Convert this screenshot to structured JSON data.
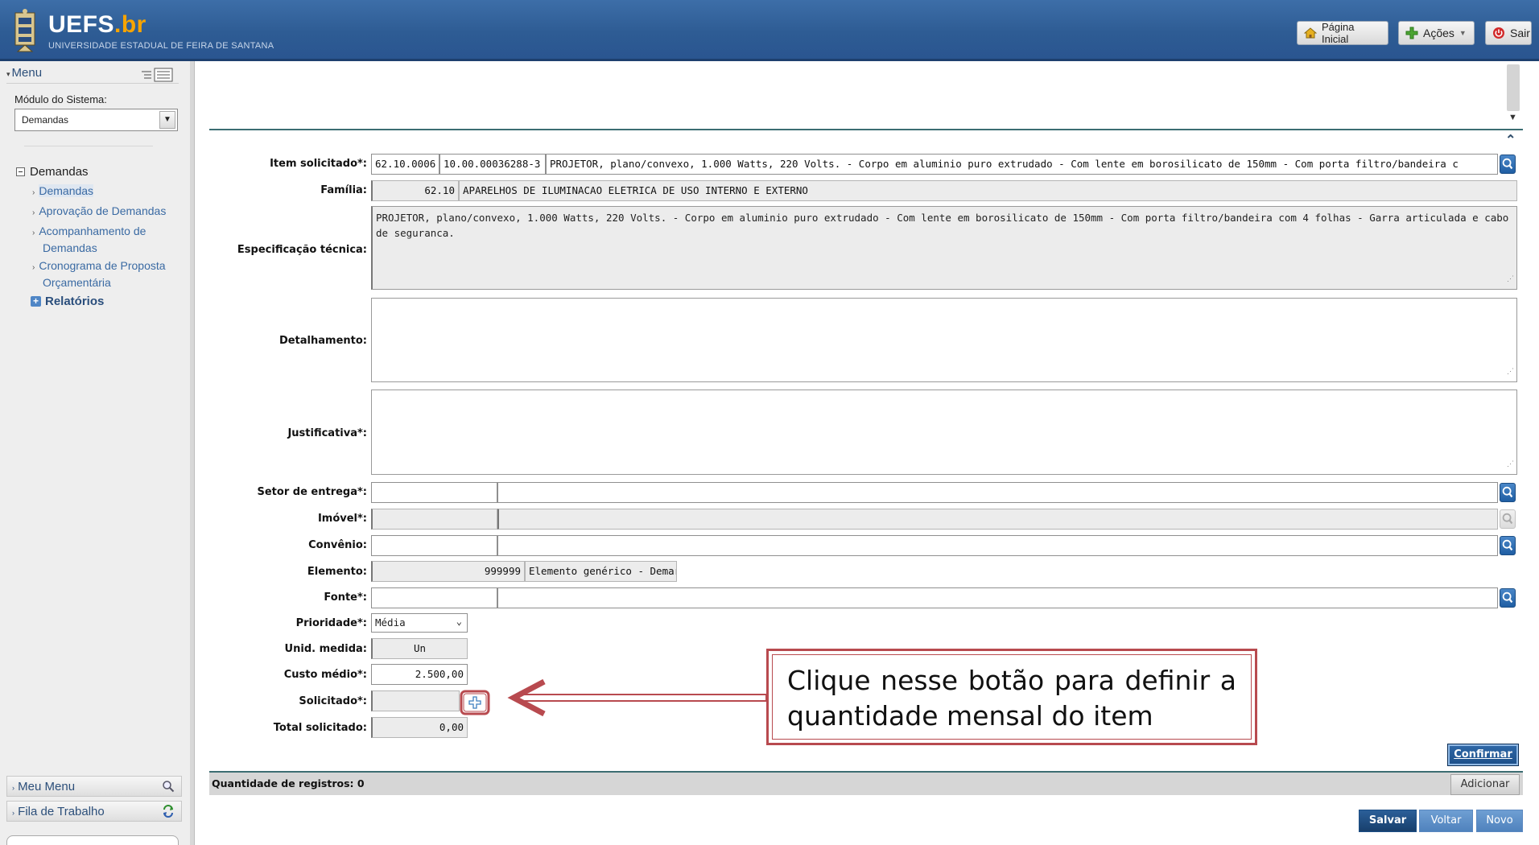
{
  "header": {
    "logo_title": "UEFS",
    "logo_suffix": ".br",
    "logo_subtitle": "UNIVERSIDADE ESTADUAL DE FEIRA DE SANTANA",
    "home_button": "Página Inicial",
    "actions_button": "Ações",
    "exit_button": "Sair"
  },
  "sidebar": {
    "menu_label": "Menu",
    "module_label": "Módulo do Sistema:",
    "module_value": "Demandas",
    "group_label": "Demandas",
    "items": [
      {
        "label": "Demandas"
      },
      {
        "label": "Aprovação de Demandas"
      },
      {
        "label_line1": "Acompanhamento de",
        "label_line2": "Demandas"
      },
      {
        "label_line1": "Cronograma de Proposta",
        "label_line2": "Orçamentária"
      }
    ],
    "reports_label": "Relatórios",
    "my_menu": "Meu Menu",
    "work_queue": "Fila de Trabalho"
  },
  "form": {
    "item_label": "Item solicitado*:",
    "item_code": "62.10.0006",
    "item_ref": "10.00.00036288-3",
    "item_desc": "PROJETOR, plano/convexo, 1.000 Watts, 220 Volts. - Corpo em aluminio puro extrudado - Com lente em borosilicato de 150mm - Com porta filtro/bandeira c",
    "family_label": "Família:",
    "family_code": "62.10",
    "family_desc": "APARELHOS DE ILUMINACAO ELETRICA DE USO INTERNO E EXTERNO",
    "spec_label": "Especificação técnica:",
    "spec_value": "PROJETOR, plano/convexo, 1.000 Watts, 220 Volts. - Corpo em aluminio puro extrudado - Com lente em borosilicato de 150mm - Com porta filtro/bandeira com 4 folhas - Garra articulada e cabo de seguranca.",
    "detail_label": "Detalhamento:",
    "justification_label": "Justificativa*:",
    "delivery_label": "Setor de entrega*:",
    "property_label": "Imóvel*:",
    "agreement_label": "Convênio:",
    "element_label": "Elemento:",
    "element_code": "999999",
    "element_desc": "Elemento genérico - Demar",
    "source_label": "Fonte*:",
    "priority_label": "Prioridade*:",
    "priority_value": "Média",
    "unit_label": "Unid. medida:",
    "unit_value": "Un",
    "cost_label": "Custo médio*:",
    "cost_value": "2.500,00",
    "requested_label": "Solicitado*:",
    "total_label": "Total solicitado:",
    "total_value": "0,00"
  },
  "callout": {
    "text": "Clique nesse botão para definir a quantidade mensal do item"
  },
  "actions": {
    "confirm": "Confirmar",
    "records": "Quantidade de registros: 0",
    "add": "Adicionar",
    "save": "Salvar",
    "back": "Voltar",
    "new": "Novo"
  },
  "colors": {
    "header_blue": "#2e5c94",
    "accent_orange": "#f7a400",
    "callout_red": "#b84a4f",
    "primary_button": "#1c4f88"
  }
}
